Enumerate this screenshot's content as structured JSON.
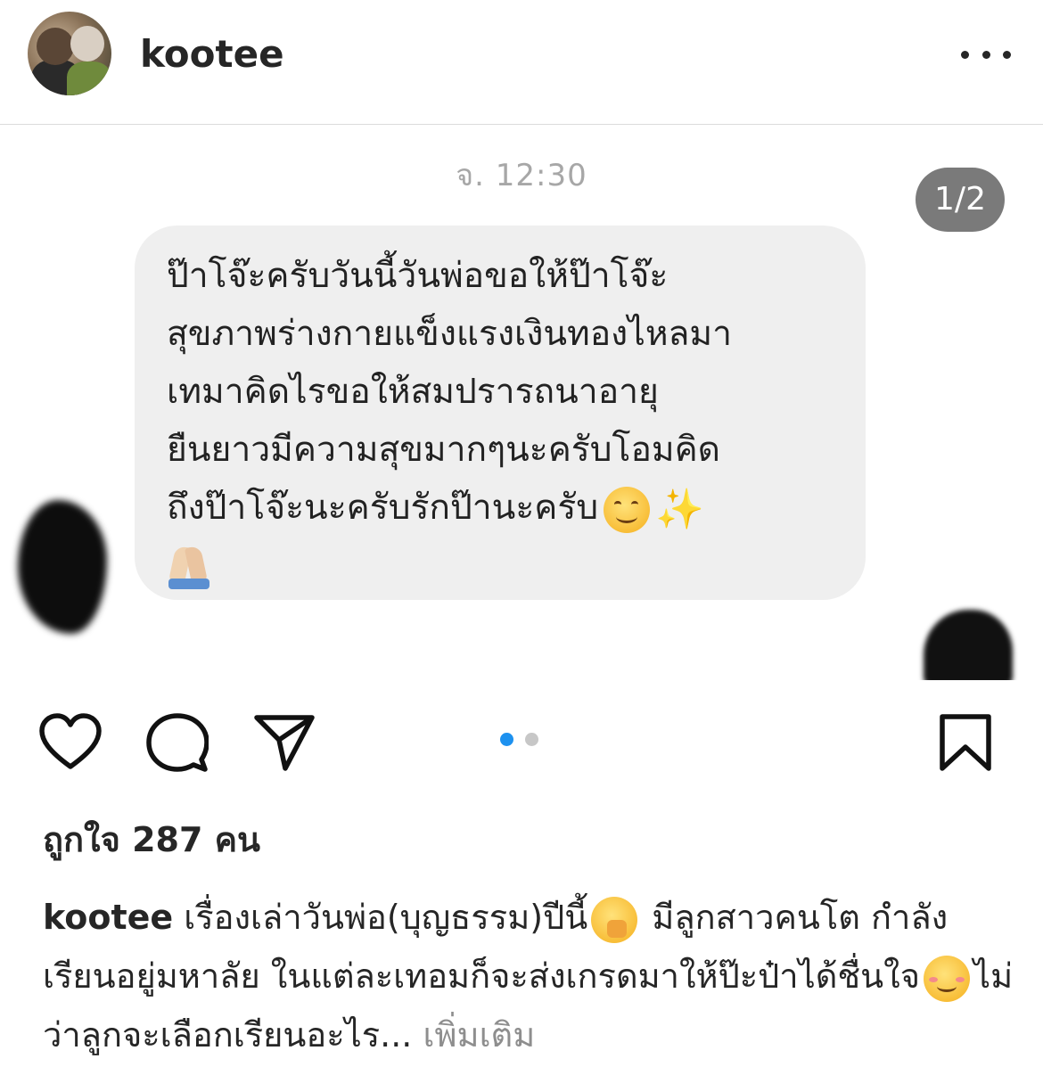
{
  "header": {
    "username": "kootee",
    "more_label": "•••"
  },
  "post": {
    "message_time": "จ. 12:30",
    "counter": "1/2",
    "message_lines": [
      "ป๊าโจ๊ะครับวันนี้วันพ่อขอให้ป๊าโจ๊ะ",
      "สุขภาพร่างกายแข็งแรงเงินทองไหลมา",
      "เทมาคิดไรขอให้สมปรารถนาอายุ",
      "ยืนยาวมีความสุขมากๆนะครับโอมคิด",
      "ถึงป๊าโจ๊ะนะครับรักป๊านะครับ"
    ],
    "emojis": [
      "smiling-face-emoji",
      "sparkles-emoji",
      "folded-hands-emoji"
    ],
    "sparkles_glyph": "✨",
    "carousel_total": 2,
    "carousel_active": 1
  },
  "actions": {
    "like_icon": "heart-icon",
    "comment_icon": "comment-icon",
    "share_icon": "paper-plane-icon",
    "save_icon": "bookmark-icon"
  },
  "likes": {
    "text": "ถูกใจ 287 คน"
  },
  "caption": {
    "username": "kootee",
    "part1": "เรื่องเล่าวันพ่อ(บุญธรรม)ปีนี้",
    "part2": "มีลูกสาวคนโต กำลังเรียนอยู่มหาลัย  ในแต่ละเทอมก็จะส่งเกรดมาให้ป๊ะป๋าได้ชื่นใจ",
    "part3": "ไม่ว่าลูกจะเลือกเรียนอะไร...",
    "more": "เพิ่มเติม"
  },
  "colors": {
    "bubble": "#efefef",
    "counter_bg": "#7a7a7a",
    "active_dot": "#1d91ef",
    "muted_text": "#8e8e8e"
  }
}
